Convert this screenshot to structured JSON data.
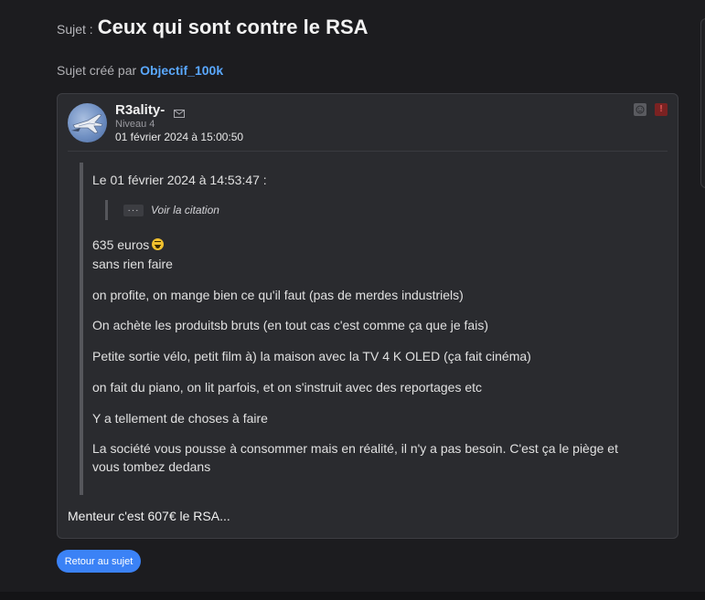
{
  "topic": {
    "prefix": "Sujet :",
    "title": "Ceux qui sont contre le RSA",
    "created_by_label": "Sujet créé par",
    "created_by_user": "Objectif_100k"
  },
  "post": {
    "username": "R3ality-",
    "level": "Niveau 4",
    "date": "01 février 2024 à 15:00:50",
    "icons": {
      "mail": "mail-icon",
      "ignore": "ignore-user-icon",
      "report": "report-icon"
    },
    "quote": {
      "header": "Le 01 février 2024 à 14:53:47 :",
      "nested_button": "···",
      "nested_label": "Voir la citation",
      "lines": [
        "635 euros",
        "sans rien faire",
        "on profite, on mange bien ce qu'il faut (pas de merdes industriels)",
        "On achète les produitsb bruts (en tout cas c'est comme ça que je fais)",
        "Petite sortie vélo, petit film à) la maison avec la TV 4 K OLED (ça fait cinéma)",
        "on fait du piano, on lit parfois, et on s'instruit avec des reportages etc",
        "Y a tellement de choses à faire",
        "La société vous pousse à consommer mais en réalité, il n'y a pas besoin. C'est ça le piège et vous tombez dedans"
      ],
      "emoji": "grimacing-face-emoji"
    },
    "reply": "Menteur c'est 607€ le RSA..."
  },
  "footer": {
    "back_button": "Retour au sujet"
  },
  "colors": {
    "background": "#1c1c1f",
    "card": "#2a2b2f",
    "link": "#5aa8ff",
    "button": "#3b82f6",
    "report": "#7a2222"
  }
}
